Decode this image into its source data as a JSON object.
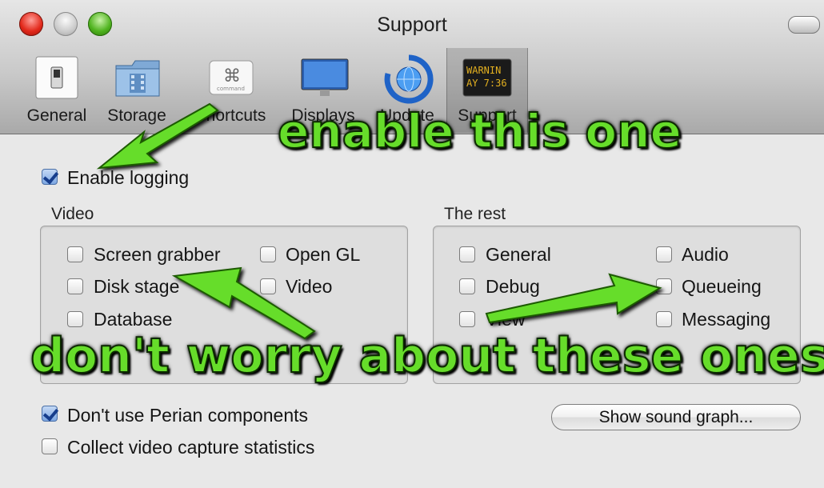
{
  "window": {
    "title": "Support"
  },
  "toolbar": {
    "items": [
      {
        "label": "General",
        "icon": "switch-icon"
      },
      {
        "label": "Storage",
        "icon": "folder-film-icon"
      },
      {
        "label": "Shortcuts",
        "icon": "command-key-icon"
      },
      {
        "label": "Displays",
        "icon": "monitor-icon"
      },
      {
        "label": "Update",
        "icon": "globe-arrows-icon"
      },
      {
        "label": "Support",
        "icon": "warning-console-icon"
      }
    ],
    "support_icon_lines": [
      "WARNIN",
      "AY 7:36"
    ],
    "selected": "Support"
  },
  "main": {
    "enable_logging": {
      "label": "Enable logging",
      "checked": true
    },
    "video": {
      "title": "Video",
      "options": [
        {
          "label": "Screen grabber",
          "checked": false
        },
        {
          "label": "Open GL",
          "checked": false
        },
        {
          "label": "Disk stage",
          "checked": false
        },
        {
          "label": "Video",
          "checked": false
        },
        {
          "label": "Database",
          "checked": false
        }
      ]
    },
    "rest": {
      "title": "The rest",
      "options": [
        {
          "label": "General",
          "checked": false
        },
        {
          "label": "Audio",
          "checked": false
        },
        {
          "label": "Debug",
          "checked": false
        },
        {
          "label": "Queueing",
          "checked": false
        },
        {
          "label": "View",
          "checked": false
        },
        {
          "label": "Messaging",
          "checked": false
        }
      ]
    },
    "perian": {
      "label": "Don't use Perian components",
      "checked": true
    },
    "stats": {
      "label": "Collect video capture statistics",
      "checked": false
    },
    "sound_button": "Show sound graph..."
  },
  "annotations": {
    "top": "enable this one",
    "bottom": "don't worry about these ones",
    "color": "#66dd2a"
  },
  "colors": {
    "accent_check": "#163d8c",
    "window_bg": "#e8e8e8"
  }
}
